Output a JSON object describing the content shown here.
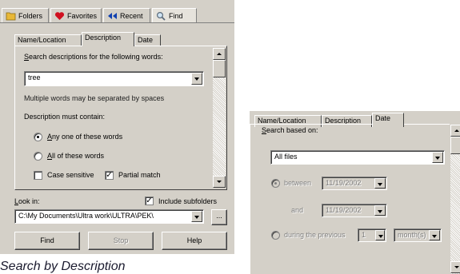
{
  "toolbar": {
    "buttons": [
      {
        "label": "Folders",
        "icon": "folder-icon"
      },
      {
        "label": "Favorites",
        "icon": "heart-icon"
      },
      {
        "label": "Recent",
        "icon": "recent-arrows-icon"
      },
      {
        "label": "Find",
        "icon": "magnifier-icon"
      }
    ]
  },
  "left_panel": {
    "tabs": [
      "Name/Location",
      "Description",
      "Date"
    ],
    "selected_tab": "Description",
    "search_prompt": "Search descriptions for the following words:",
    "search_value": "tree",
    "hint": "Multiple words may be separated by spaces",
    "must_contain_label": "Description must contain:",
    "options": [
      {
        "label": "Any one of these words",
        "selected": true
      },
      {
        "label": "All of these words",
        "selected": false
      }
    ],
    "case_sensitive": {
      "label": "Case sensitive",
      "checked": false
    },
    "partial_match": {
      "label": "Partial match",
      "checked": true
    },
    "look_in_label": "Look in:",
    "include_subfolders": {
      "label": "Include subfolders",
      "checked": true
    },
    "path": "C:\\My Documents\\Ultra work\\ULTRA\\PEK\\",
    "browse_label": "...",
    "find_label": "Find",
    "stop_label": "Stop",
    "help_label": "Help"
  },
  "caption": "Search by Description",
  "right_panel": {
    "tabs": [
      "Name/Location",
      "Description",
      "Date"
    ],
    "selected_tab": "Date",
    "search_based_on_label": "Search based on:",
    "search_based_on_value": "All files",
    "between_label": "between",
    "between_date": "11/19/2002",
    "and_label": "and",
    "and_date": "11/19/2002",
    "during_label": "during the previous",
    "during_count": "1",
    "during_unit": "month(s)"
  },
  "colors": {
    "face": "#d4d0c8",
    "highlight": "#ffffff",
    "shadow": "#808080",
    "dark_shadow": "#404040",
    "heart": "#d01020",
    "folder": "#e8b838",
    "recent": "#1040b0"
  }
}
